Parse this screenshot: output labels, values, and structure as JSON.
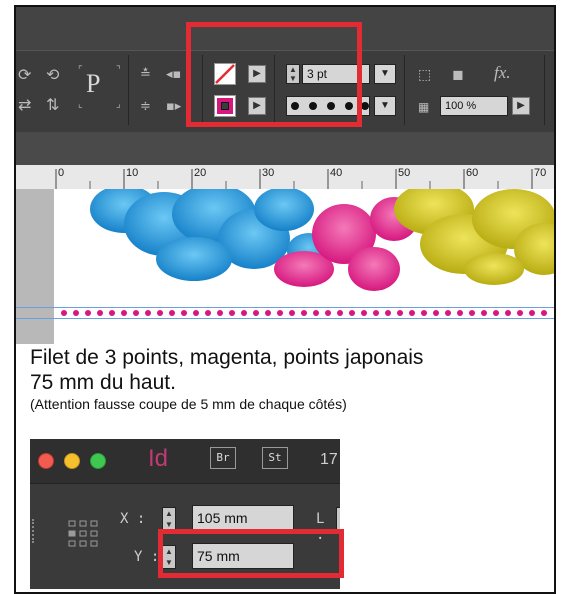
{
  "toolbar": {
    "stroke_weight": "3 pt",
    "opacity": "100 %",
    "fx_label": "fx.",
    "paragraph_glyph": "P"
  },
  "ruler": {
    "ticks": [
      "0",
      "10",
      "20",
      "30",
      "40",
      "50",
      "60",
      "70"
    ]
  },
  "caption": {
    "line1": "Filet de 3 points, magenta, points japonais",
    "line2": "75 mm du haut.",
    "line3": "(Attention fausse coupe de 5 mm de chaque côtés)"
  },
  "panel": {
    "logo": "Id",
    "bridge_btn": "Br",
    "stock_btn": "St",
    "extra_num": "17",
    "x_label": "X :",
    "x_value": "105 mm",
    "y_label": "Y :",
    "y_value": "75 mm",
    "l_label": "L :"
  },
  "colors": {
    "highlight": "#e22b33",
    "magenta": "#d6177f",
    "cyan": "#1f9fe0",
    "yellow": "#d8cc1e"
  }
}
